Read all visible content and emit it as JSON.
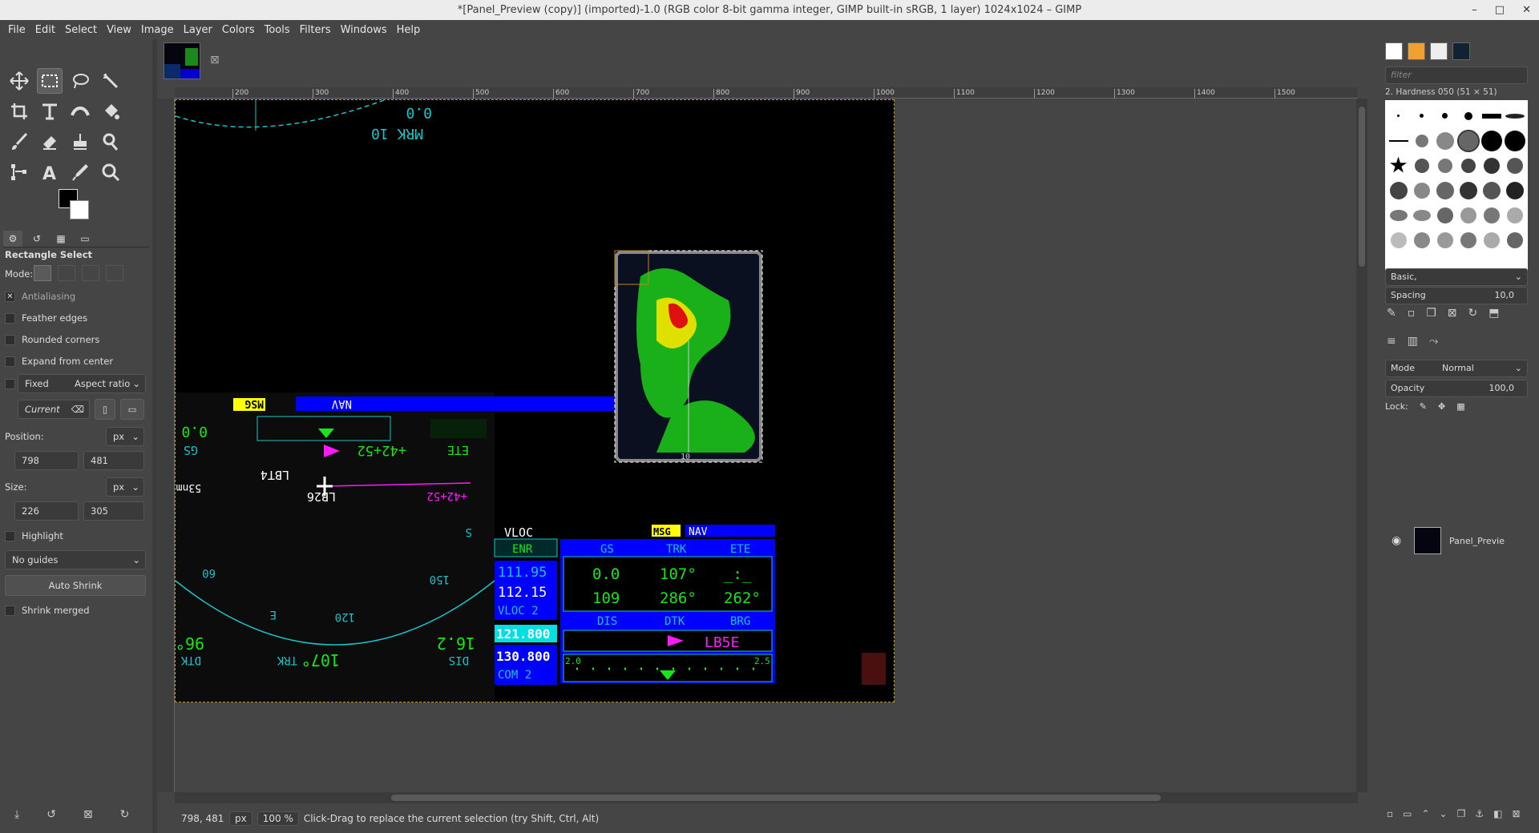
{
  "window": {
    "title": "*[Panel_Preview (copy)] (imported)-1.0 (RGB color 8-bit gamma integer, GIMP built-in sRGB, 1 layer) 1024x1024 – GIMP",
    "controls": [
      "–",
      "□",
      "✕"
    ]
  },
  "menu": [
    "File",
    "Edit",
    "Select",
    "View",
    "Image",
    "Layer",
    "Colors",
    "Tools",
    "Filters",
    "Windows",
    "Help"
  ],
  "tool_options": {
    "title": "Rectangle Select",
    "mode_label": "Mode:",
    "antialiasing": "Antialiasing",
    "feather_edges": "Feather edges",
    "rounded_corners": "Rounded corners",
    "expand_from_center": "Expand from center",
    "fixed": "Fixed",
    "fixed_option": "Aspect ratio",
    "current": "Current",
    "position_label": "Position:",
    "position_unit": "px",
    "position_x": "798",
    "position_y": "481",
    "size_label": "Size:",
    "size_unit": "px",
    "size_w": "226",
    "size_h": "305",
    "highlight": "Highlight",
    "guides": "No guides",
    "auto_shrink": "Auto Shrink",
    "shrink_merged": "Shrink merged"
  },
  "ruler": [
    "200",
    "300",
    "400",
    "500",
    "600",
    "700",
    "800",
    "900",
    "1000",
    "1100",
    "1200",
    "1300",
    "1400",
    "1500"
  ],
  "status": {
    "coords": "798, 481",
    "unit": "px",
    "zoom": "100 %",
    "message": "Click-Drag to replace the current selection (try Shift, Ctrl, Alt)"
  },
  "brushes": {
    "filter_placeholder": "filter",
    "selected_name": "2. Hardness 050 (51 × 51)",
    "preset": "Basic,",
    "spacing_label": "Spacing",
    "spacing_value": "10,0"
  },
  "layers": {
    "mode_label": "Mode",
    "mode_value": "Normal",
    "opacity_label": "Opacity",
    "opacity_value": "100,0",
    "lock_label": "Lock:",
    "layer_name": "Panel_Previe"
  },
  "panel_text": {
    "top_a": "0.0",
    "top_b": "MRK 10",
    "msg": "MSG",
    "nav": "NAV",
    "lbl_00": "0.0",
    "gs": "GS",
    "ete": "ETE",
    "mag_wpt": "+42+52",
    "lbt4": "LBT4",
    "lb26": "LB26",
    "mag_wpt2": "+42+52",
    "s53nm": "53nm",
    "s_label": "S",
    "h60": "60",
    "h150": "150",
    "e_label": "E",
    "h120": "120",
    "trk": "TRK",
    "trk_val": "107°",
    "dtk_val": "96°",
    "dtk": "DTK",
    "dis_val": "16.2",
    "dis": "DIS",
    "vloc": "VLOC",
    "msg2": "MSG",
    "nav2": "NAV",
    "enr": "ENR",
    "freq1": "111.95",
    "freq2": "112.15",
    "vloc2": "VLOC 2",
    "freq3": "121.800",
    "freq4": "130.800",
    "com2": "COM 2",
    "gs2": "GS",
    "trk2": "TRK",
    "ete2": "ETE",
    "v00": "0.0",
    "v107": "107°",
    "vdash": "_:_",
    "v109": "109",
    "v286": "286°",
    "v262": "262°",
    "dis2": "DIS",
    "dtk2": "DTK",
    "brg": "BRG",
    "wpt": "LB5E",
    "cdi_l": "2.0",
    "cdi_r": "2.5",
    "range": "10"
  },
  "colors": {
    "cyan": "#19c3c8",
    "green": "#19e619",
    "magenta": "#ff19ff",
    "nav_blue": "#0000ff",
    "msg_yellow": "#ffff00"
  }
}
